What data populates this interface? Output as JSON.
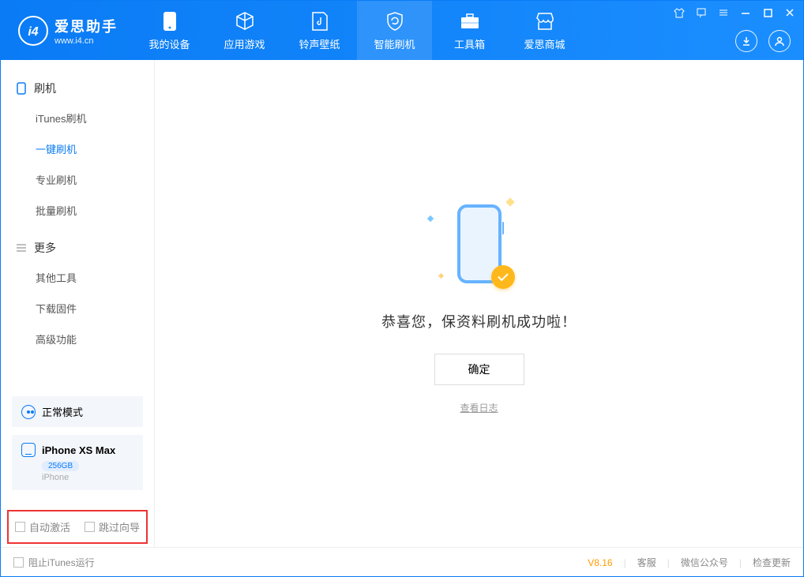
{
  "app": {
    "name": "爱思助手",
    "url": "www.i4.cn"
  },
  "tabs": [
    {
      "label": "我的设备"
    },
    {
      "label": "应用游戏"
    },
    {
      "label": "铃声壁纸"
    },
    {
      "label": "智能刷机"
    },
    {
      "label": "工具箱"
    },
    {
      "label": "爱思商城"
    }
  ],
  "sidebar": {
    "section1": {
      "title": "刷机",
      "items": [
        "iTunes刷机",
        "一键刷机",
        "专业刷机",
        "批量刷机"
      ]
    },
    "section2": {
      "title": "更多",
      "items": [
        "其他工具",
        "下载固件",
        "高级功能"
      ]
    }
  },
  "mode": {
    "label": "正常模式"
  },
  "device": {
    "name": "iPhone XS Max",
    "capacity": "256GB",
    "type": "iPhone"
  },
  "checks": {
    "auto_activate": "自动激活",
    "skip_wizard": "跳过向导"
  },
  "main": {
    "message": "恭喜您，保资料刷机成功啦！",
    "ok": "确定",
    "log_link": "查看日志"
  },
  "footer": {
    "block_itunes": "阻止iTunes运行",
    "version": "V8.16",
    "support": "客服",
    "wechat": "微信公众号",
    "update": "检查更新"
  }
}
